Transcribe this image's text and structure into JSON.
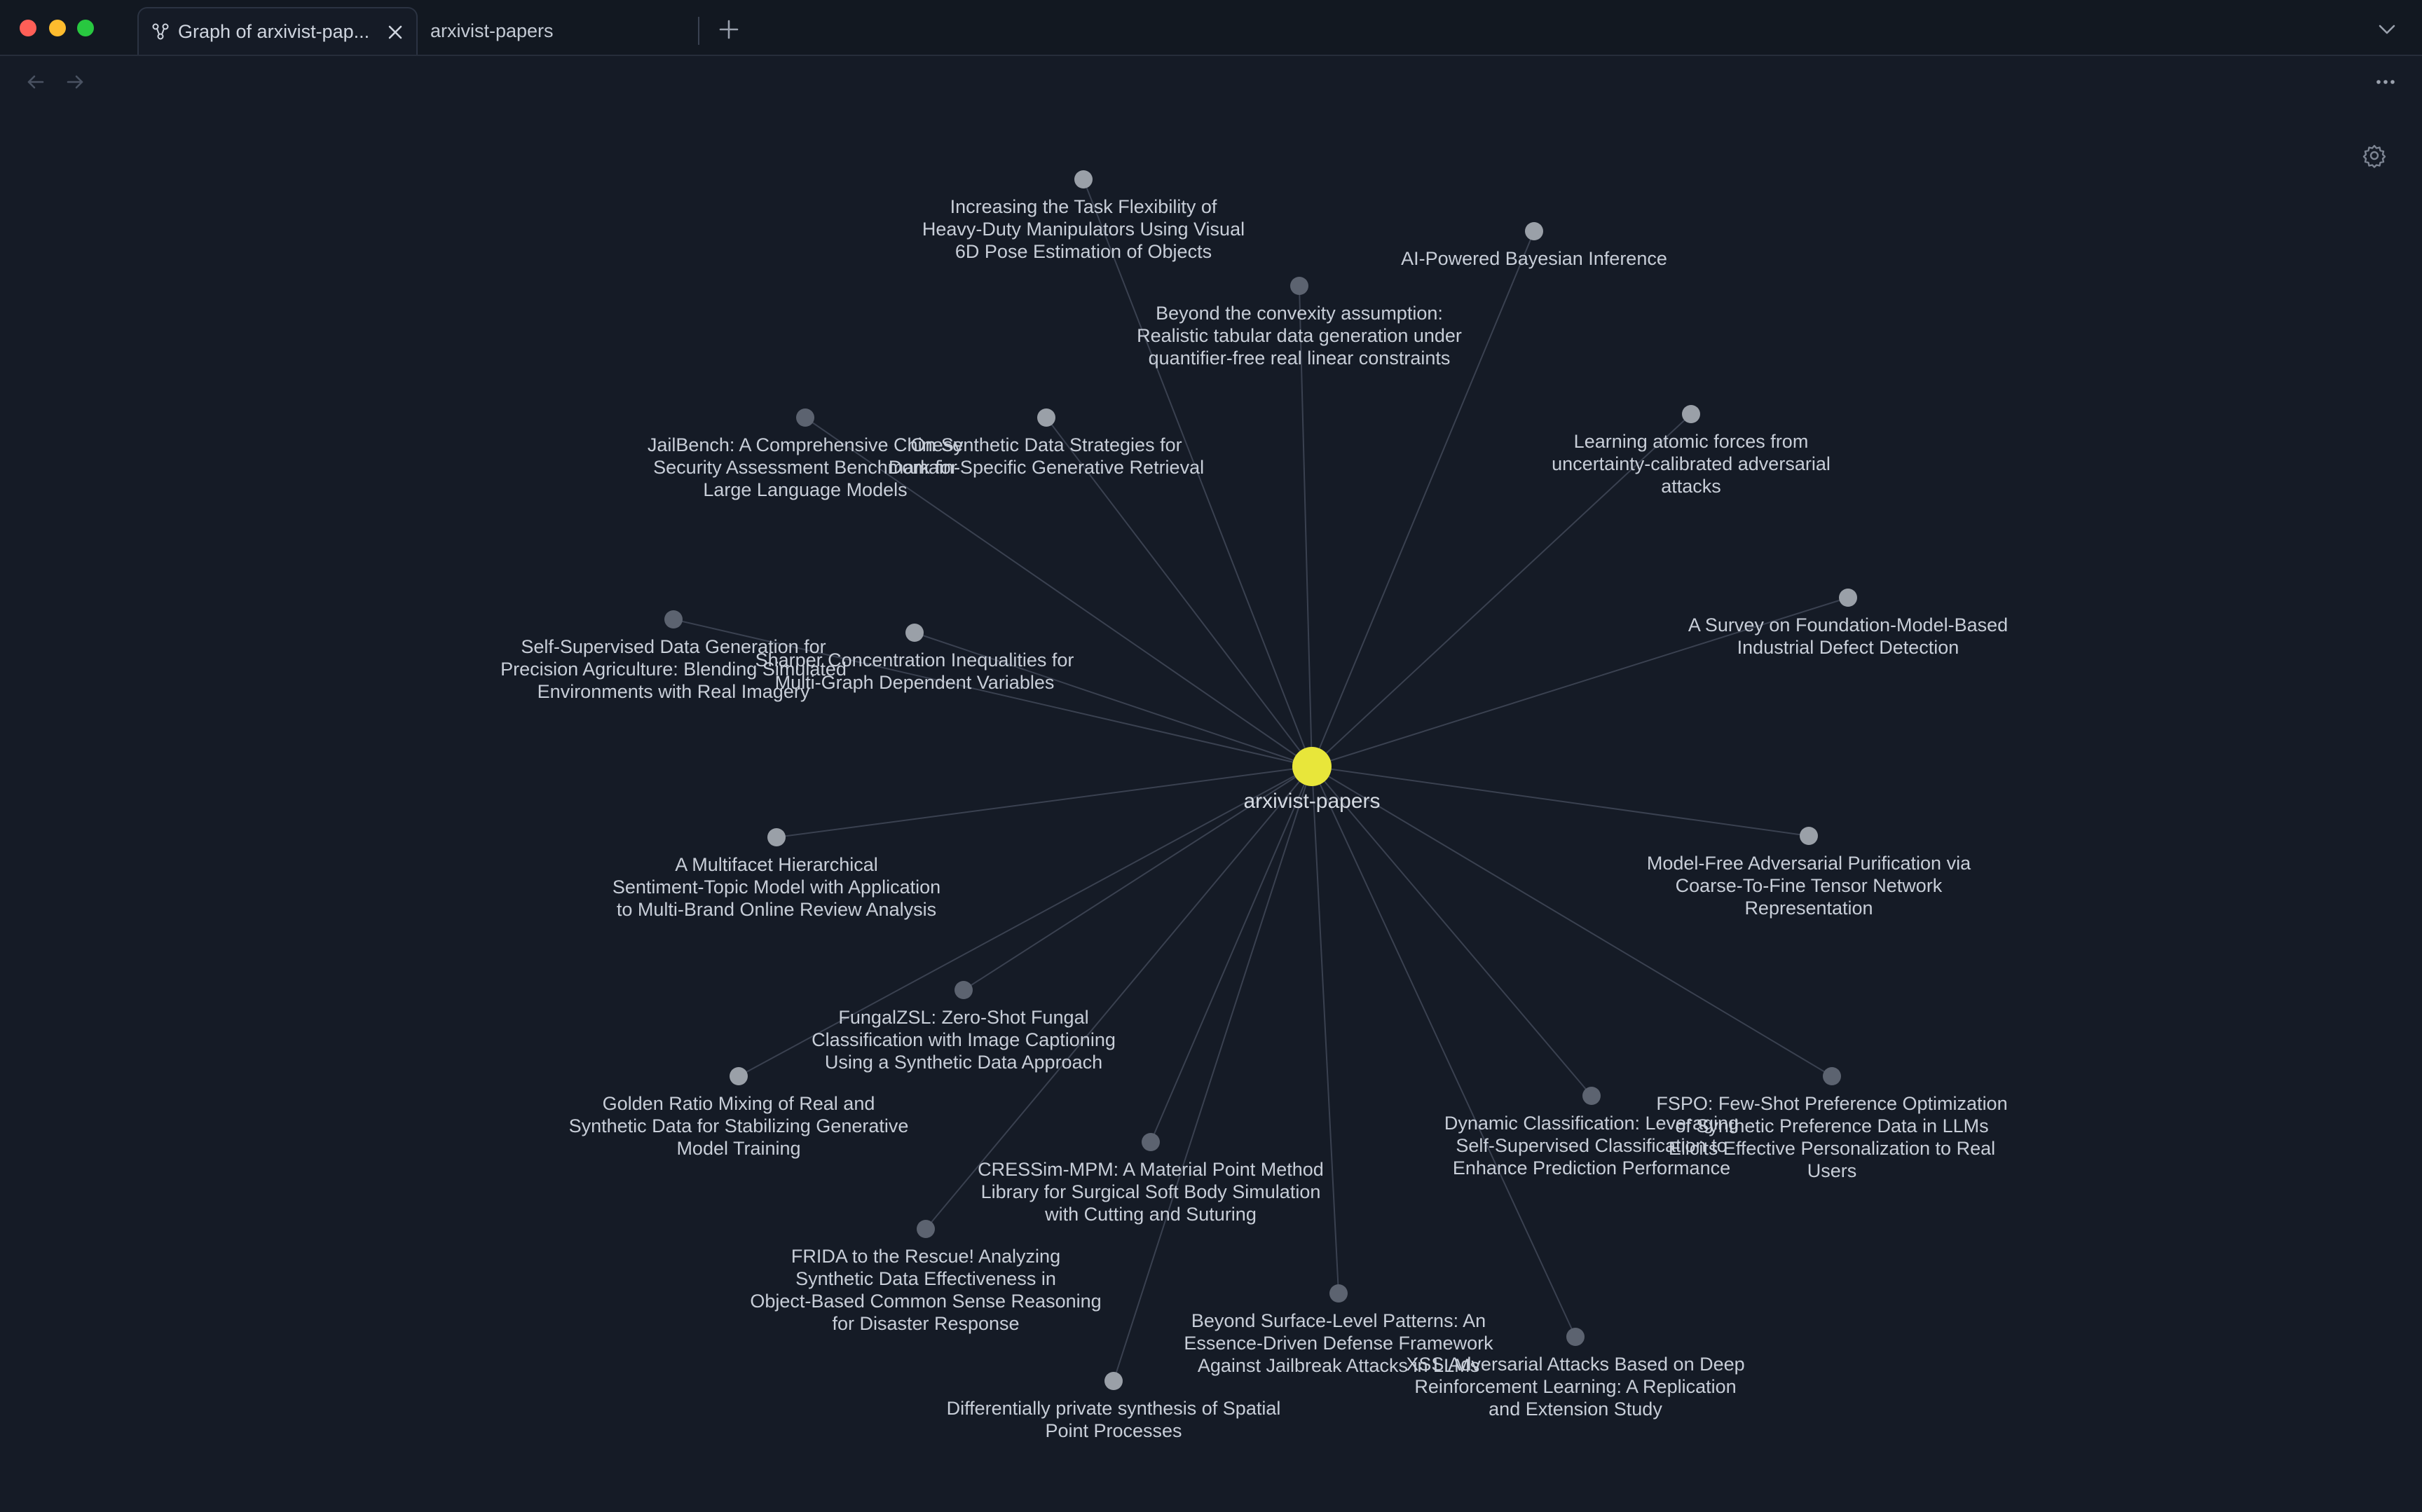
{
  "tabs": [
    {
      "title": "Graph of arxivist-pap...",
      "active": true,
      "icon": "graph-icon"
    },
    {
      "title": "arxivist-papers",
      "active": false
    }
  ],
  "colors": {
    "center_node": "#e8e63a",
    "node": "#9aa0a8",
    "node_dim": "#5c6370",
    "edge": "#3a4150",
    "background": "#151b26"
  },
  "graph": {
    "center": {
      "label": "arxivist-papers"
    },
    "nodes": [
      {
        "lines": [
          "Increasing the Task Flexibility of",
          "Heavy-Duty Manipulators Using Visual",
          "6D Pose Estimation of Objects"
        ]
      },
      {
        "lines": [
          "AI-Powered Bayesian Inference"
        ]
      },
      {
        "lines": [
          "Beyond the convexity assumption:",
          "Realistic tabular data generation under",
          "quantifier-free real linear constraints"
        ]
      },
      {
        "lines": [
          "JailBench: A Comprehensive Chinese",
          "Security Assessment Benchmark for",
          "Large Language Models"
        ]
      },
      {
        "lines": [
          "On Synthetic Data Strategies for",
          "Domain-Specific Generative Retrieval"
        ]
      },
      {
        "lines": [
          "Learning atomic forces from",
          "uncertainty-calibrated adversarial",
          "attacks"
        ]
      },
      {
        "lines": [
          "A Survey on Foundation-Model-Based",
          "Industrial Defect Detection"
        ]
      },
      {
        "lines": [
          "Self-Supervised Data Generation for",
          "Precision Agriculture: Blending Simulated",
          "Environments with Real Imagery"
        ]
      },
      {
        "lines": [
          "Sharper Concentration Inequalities for",
          "Multi-Graph Dependent Variables"
        ]
      },
      {
        "lines": [
          "A Multifacet Hierarchical",
          "Sentiment-Topic Model with Application",
          "to Multi-Brand Online Review Analysis"
        ]
      },
      {
        "lines": [
          "Model-Free Adversarial Purification via",
          "Coarse-To-Fine Tensor Network",
          "Representation"
        ]
      },
      {
        "lines": [
          "FungalZSL: Zero-Shot Fungal",
          "Classification with Image Captioning",
          "Using a Synthetic Data Approach"
        ]
      },
      {
        "lines": [
          "Golden Ratio Mixing of Real and",
          "Synthetic Data for Stabilizing Generative",
          "Model Training"
        ]
      },
      {
        "lines": [
          "Dynamic Classification: Leveraging",
          "Self-Supervised Classification to",
          "Enhance Prediction Performance"
        ]
      },
      {
        "lines": [
          "FSPO: Few-Shot Preference Optimization",
          "of Synthetic Preference Data in LLMs",
          "Elicits Effective Personalization to Real",
          "Users"
        ]
      },
      {
        "lines": [
          "CRESSim-MPM: A Material Point Method",
          "Library for Surgical Soft Body Simulation",
          "with Cutting and Suturing"
        ]
      },
      {
        "lines": [
          "FRIDA to the Rescue! Analyzing",
          "Synthetic Data Effectiveness in",
          "Object-Based Common Sense Reasoning",
          "for Disaster Response"
        ]
      },
      {
        "lines": [
          "Beyond Surface-Level Patterns: An",
          "Essence-Driven Defense Framework",
          "Against Jailbreak Attacks in LLMs"
        ]
      },
      {
        "lines": [
          "XSS Adversarial Attacks Based on Deep",
          "Reinforcement Learning: A Replication",
          "and Extension Study"
        ]
      },
      {
        "lines": [
          "Differentially private synthesis of Spatial",
          "Point Processes"
        ]
      }
    ]
  }
}
